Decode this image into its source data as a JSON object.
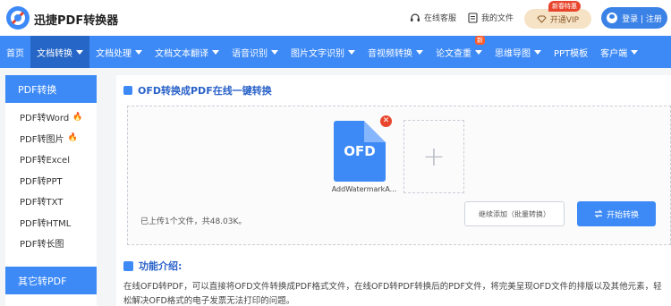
{
  "header": {
    "brand": "迅捷PDF转换器",
    "customer_service": "在线客服",
    "my_files": "我的文件",
    "vip_label": "开通VIP",
    "vip_badge": "新春特惠",
    "login_label": "登录 | 注册",
    "accent": "#3d8af7"
  },
  "nav": {
    "items": [
      {
        "label": "首页",
        "dropdown": false
      },
      {
        "label": "文档转换",
        "dropdown": true,
        "active": true
      },
      {
        "label": "文档处理",
        "dropdown": true
      },
      {
        "label": "文档文本翻译",
        "dropdown": true
      },
      {
        "label": "语音识别",
        "dropdown": true
      },
      {
        "label": "图片文字识别",
        "dropdown": true
      },
      {
        "label": "音视频转换",
        "dropdown": true
      },
      {
        "label": "论文查重",
        "dropdown": true,
        "badge": "新"
      },
      {
        "label": "思维导图",
        "dropdown": true
      },
      {
        "label": "PPT模板",
        "dropdown": false
      },
      {
        "label": "客户端",
        "dropdown": true
      }
    ]
  },
  "sidebar": {
    "section1": "PDF转换",
    "items": [
      {
        "label": "PDF转Word",
        "hot": true
      },
      {
        "label": "PDF转图片",
        "hot": true
      },
      {
        "label": "PDF转Excel",
        "hot": false
      },
      {
        "label": "PDF转PPT",
        "hot": false
      },
      {
        "label": "PDF转TXT",
        "hot": false
      },
      {
        "label": "PDF转HTML",
        "hot": false
      },
      {
        "label": "PDF转长图",
        "hot": false
      }
    ],
    "section2": "其它转PDF"
  },
  "main": {
    "title": "OFD转换成PDF在线一键转换",
    "file": {
      "type_label": "OFD",
      "name": "AddWatermarkA..."
    },
    "add_symbol": "+",
    "upload_status": "已上传1个文件，共48.03K。",
    "continue_button": "继续添加（批量转换）",
    "start_button": "开始转换",
    "intro_title": "功能介绍:",
    "intro_text": "在线OFD转PDF，可以直接将OFD文件转换成PDF格式文件，在线OFD转PDF转换后的PDF文件，将完美呈现OFD文件的排版以及其他元素，轻松解决OFD格式的电子发票无法打印的问题。"
  }
}
